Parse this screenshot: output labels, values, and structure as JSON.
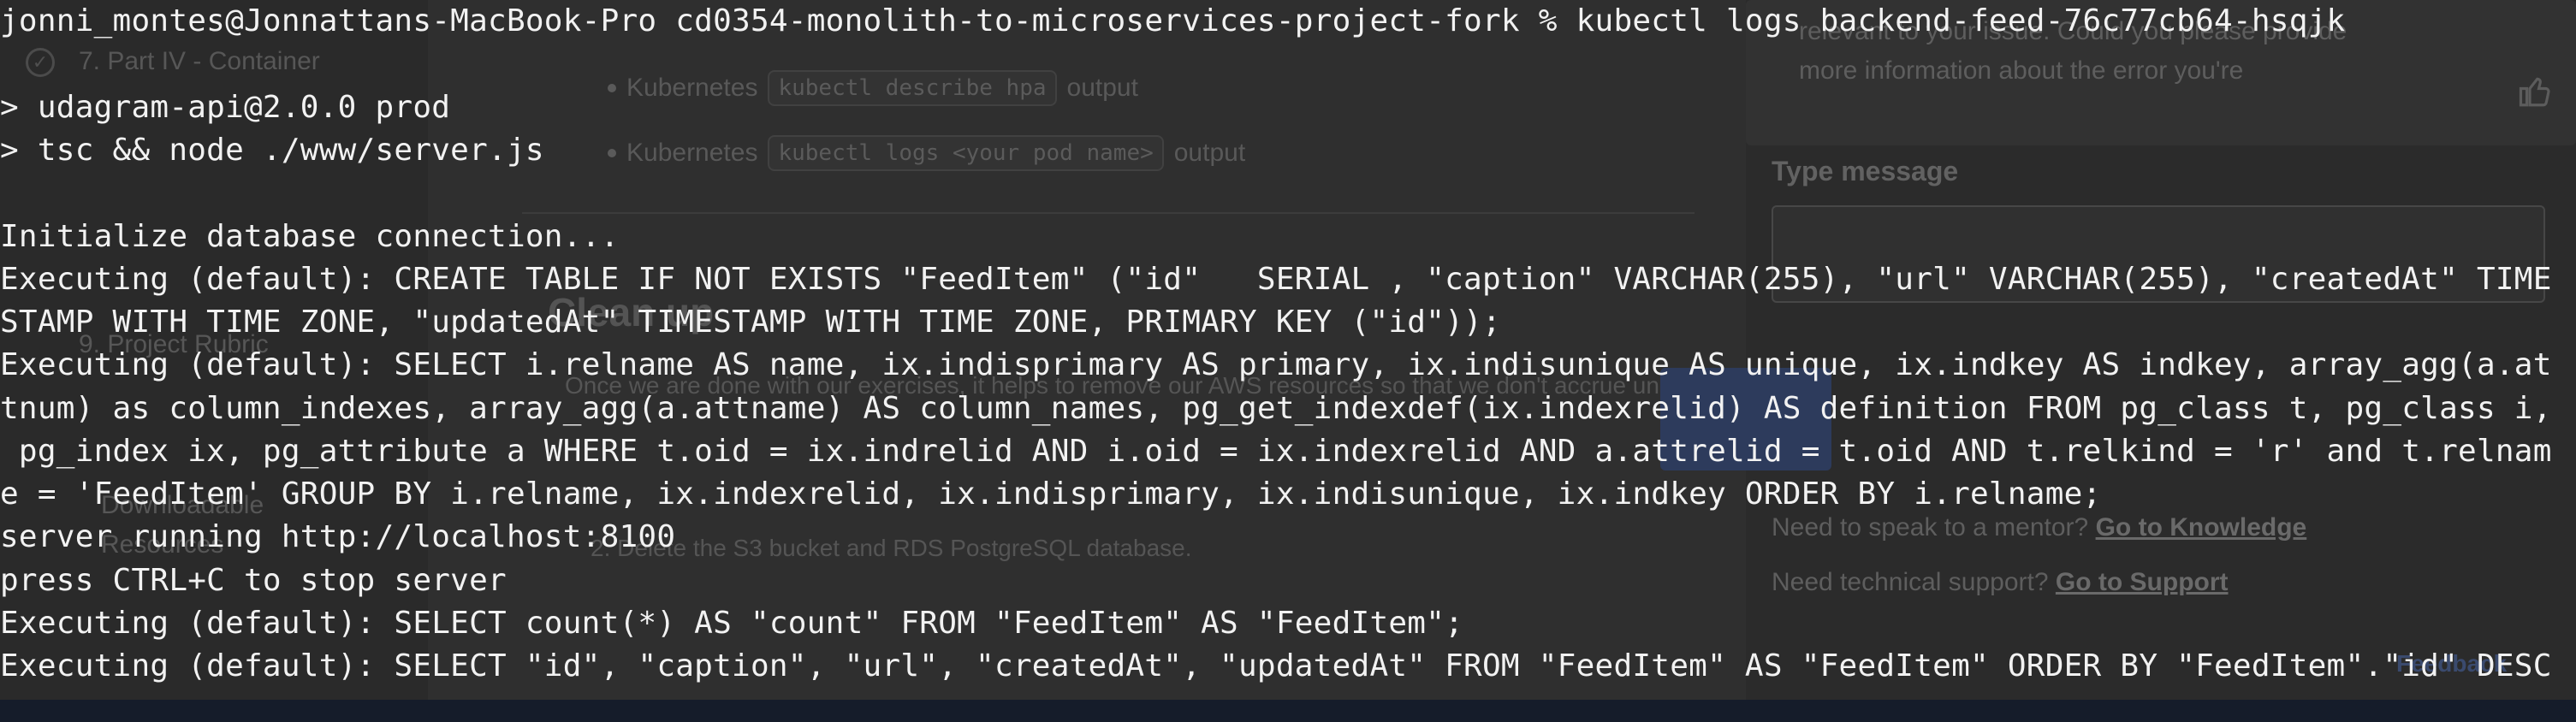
{
  "background": {
    "sidebar": {
      "items": [
        {
          "label": "7. Part IV - Container"
        },
        {
          "label": "9. Project Rubric"
        },
        {
          "label": "Downloadable"
        },
        {
          "label": "Resources"
        }
      ]
    },
    "main": {
      "bullets": [
        {
          "prefix": "Kubernetes",
          "code": "kubectl describe hpa",
          "suffix": "output"
        },
        {
          "prefix": "Kubernetes",
          "code": "kubectl logs <your pod name>",
          "suffix": "output"
        }
      ],
      "cleanup_heading": "Clean up",
      "cleanup_paragraph": "Once we are done with our exercises, it helps to remove our AWS resources so that we don't accrue unnecessary charges to our AWS balance.",
      "cleanup_step_2": "2. Delete the S3 bucket and RDS PostgreSQL database."
    },
    "chat": {
      "message_lines": [
        "relevant to your issue. Could you please provide",
        "more information about the error you're"
      ],
      "type_message_label": "Type message",
      "mentor_text": "Need to speak to a mentor?",
      "mentor_link": "Go to Knowledge",
      "support_text": "Need technical support?",
      "support_link": "Go to Support",
      "feedback_label": "Feedback"
    }
  },
  "terminal": {
    "lines": [
      "jonni_montes@Jonnattans-MacBook-Pro cd0354-monolith-to-microservices-project-fork % kubectl logs backend-feed-76c77cb64-hsqjk",
      "",
      "> udagram-api@2.0.0 prod",
      "> tsc && node ./www/server.js",
      "",
      "Initialize database connection...",
      "Executing (default): CREATE TABLE IF NOT EXISTS \"FeedItem\" (\"id\"   SERIAL , \"caption\" VARCHAR(255), \"url\" VARCHAR(255), \"createdAt\" TIME",
      "STAMP WITH TIME ZONE, \"updatedAt\" TIMESTAMP WITH TIME ZONE, PRIMARY KEY (\"id\"));",
      "Executing (default): SELECT i.relname AS name, ix.indisprimary AS primary, ix.indisunique AS unique, ix.indkey AS indkey, array_agg(a.at",
      "tnum) as column_indexes, array_agg(a.attname) AS column_names, pg_get_indexdef(ix.indexrelid) AS definition FROM pg_class t, pg_class i,",
      " pg_index ix, pg_attribute a WHERE t.oid = ix.indrelid AND i.oid = ix.indexrelid AND a.attrelid = t.oid AND t.relkind = 'r' and t.relnam",
      "e = 'FeedItem' GROUP BY i.relname, ix.indexrelid, ix.indisprimary, ix.indisunique, ix.indkey ORDER BY i.relname;",
      "server running http://localhost:8100",
      "press CTRL+C to stop server",
      "Executing (default): SELECT count(*) AS \"count\" FROM \"FeedItem\" AS \"FeedItem\";",
      "Executing (default): SELECT \"id\", \"caption\", \"url\", \"createdAt\", \"updatedAt\" FROM \"FeedItem\" AS \"FeedItem\" ORDER BY \"FeedItem\".\"id\" DESC",
      ";"
    ]
  }
}
